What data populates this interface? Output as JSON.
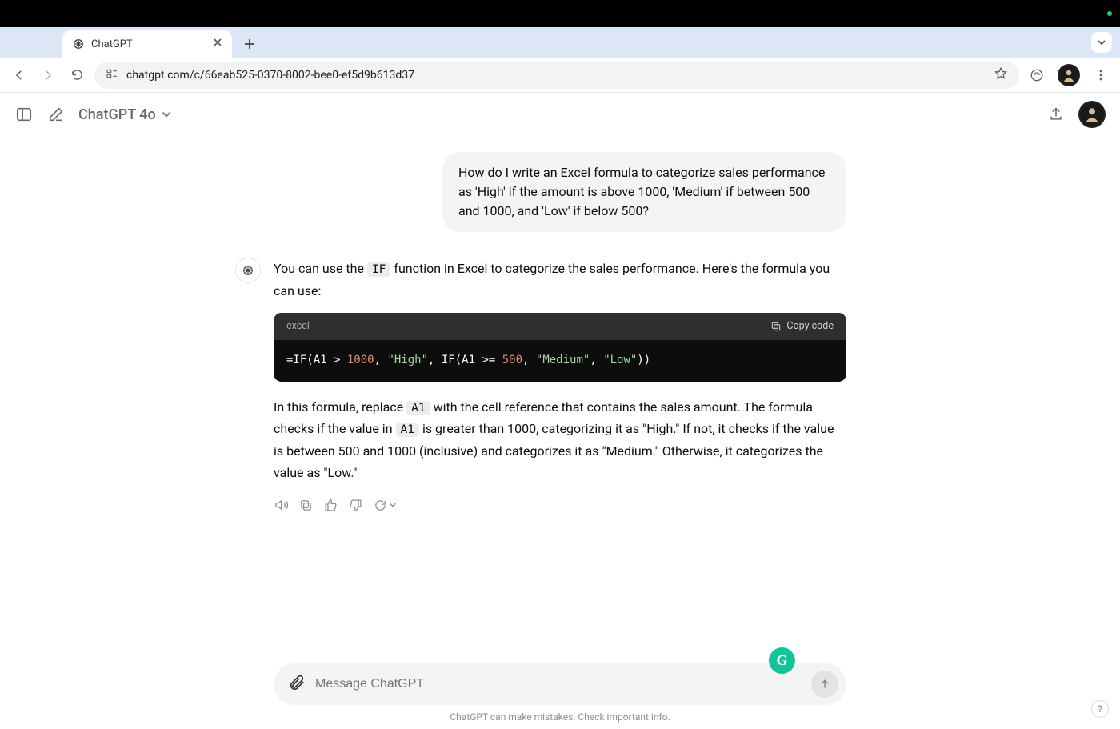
{
  "browser": {
    "tab_title": "ChatGPT",
    "url": "chatgpt.com/c/66eab525-0370-8002-bee0-ef5d9b613d37"
  },
  "header": {
    "model_label": "ChatGPT 4o"
  },
  "conversation": {
    "user_message": "How do I write an Excel formula to categorize sales performance as 'High' if the amount is above 1000, 'Medium' if between 500 and 1000, and 'Low' if below 500?",
    "assistant": {
      "intro_pre": "You can use the ",
      "intro_code": "IF",
      "intro_post": " function in Excel to categorize the sales performance. Here's the formula you can use:",
      "code_lang": "excel",
      "copy_label": "Copy code",
      "code_line": "=IF(A1 > 1000, \"High\", IF(A1 >= 500, \"Medium\", \"Low\"))",
      "explain_1a": "In this formula, replace ",
      "explain_1b": "A1",
      "explain_1c": " with the cell reference that contains the sales amount. The formula checks if the value in ",
      "explain_1d": "A1",
      "explain_1e": " is greater than 1000, categorizing it as \"High.\" If not, it checks if the value is between 500 and 1000 (inclusive) and categorizes it as \"Medium.\" Otherwise, it categorizes the value as \"Low.\""
    }
  },
  "composer": {
    "placeholder": "Message ChatGPT",
    "grammarly": "G"
  },
  "footer": {
    "disclaimer": "ChatGPT can make mistakes. Check important info.",
    "help": "?"
  }
}
